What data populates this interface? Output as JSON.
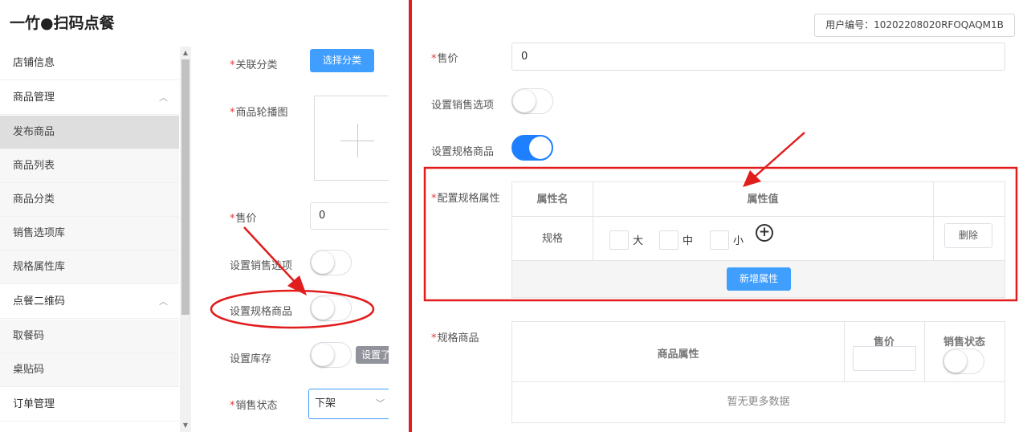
{
  "app": {
    "title": "一竹●扫码点餐"
  },
  "sidebar": {
    "items": [
      {
        "label": "店铺信息"
      },
      {
        "label": "商品管理"
      },
      {
        "label": "发布商品"
      },
      {
        "label": "商品列表"
      },
      {
        "label": "商品分类"
      },
      {
        "label": "销售选项库"
      },
      {
        "label": "规格属性库"
      },
      {
        "label": "点餐二维码"
      },
      {
        "label": "取餐码"
      },
      {
        "label": "桌贴码"
      },
      {
        "label": "订单管理"
      }
    ]
  },
  "form_left": {
    "category_label": "关联分类",
    "select_category_btn": "选择分类",
    "carousel_label": "商品轮播图",
    "price_label": "售价",
    "price_value": "0",
    "sale_option_label": "设置销售选项",
    "spec_goods_label": "设置规格商品",
    "stock_label": "设置库存",
    "stock_button": "设置了",
    "sale_status_label": "销售状态",
    "sale_status_value": "下架"
  },
  "header_right": {
    "user_id": "用户编号：10202208020RFOQAQM1B"
  },
  "form_right": {
    "price_label": "售价",
    "price_value": "0",
    "sale_option_label": "设置销售选项",
    "spec_goods_label": "设置规格商品",
    "spec_attr_label": "配置规格属性",
    "spec_table": {
      "col_name": "属性名",
      "col_value": "属性值",
      "row_name": "规格",
      "values": [
        "大",
        "中",
        "小"
      ],
      "delete_btn": "删除",
      "add_btn": "新增属性"
    },
    "sku_label": "规格商品",
    "sku_table": {
      "col_attr": "商品属性",
      "col_price": "售价",
      "col_status": "销售状态",
      "empty_text": "暂无更多数据"
    }
  },
  "colors": {
    "primary": "#409eff",
    "switch_on": "#1e80ff",
    "annotation": "#e11d1d",
    "required": "#e4393c"
  }
}
